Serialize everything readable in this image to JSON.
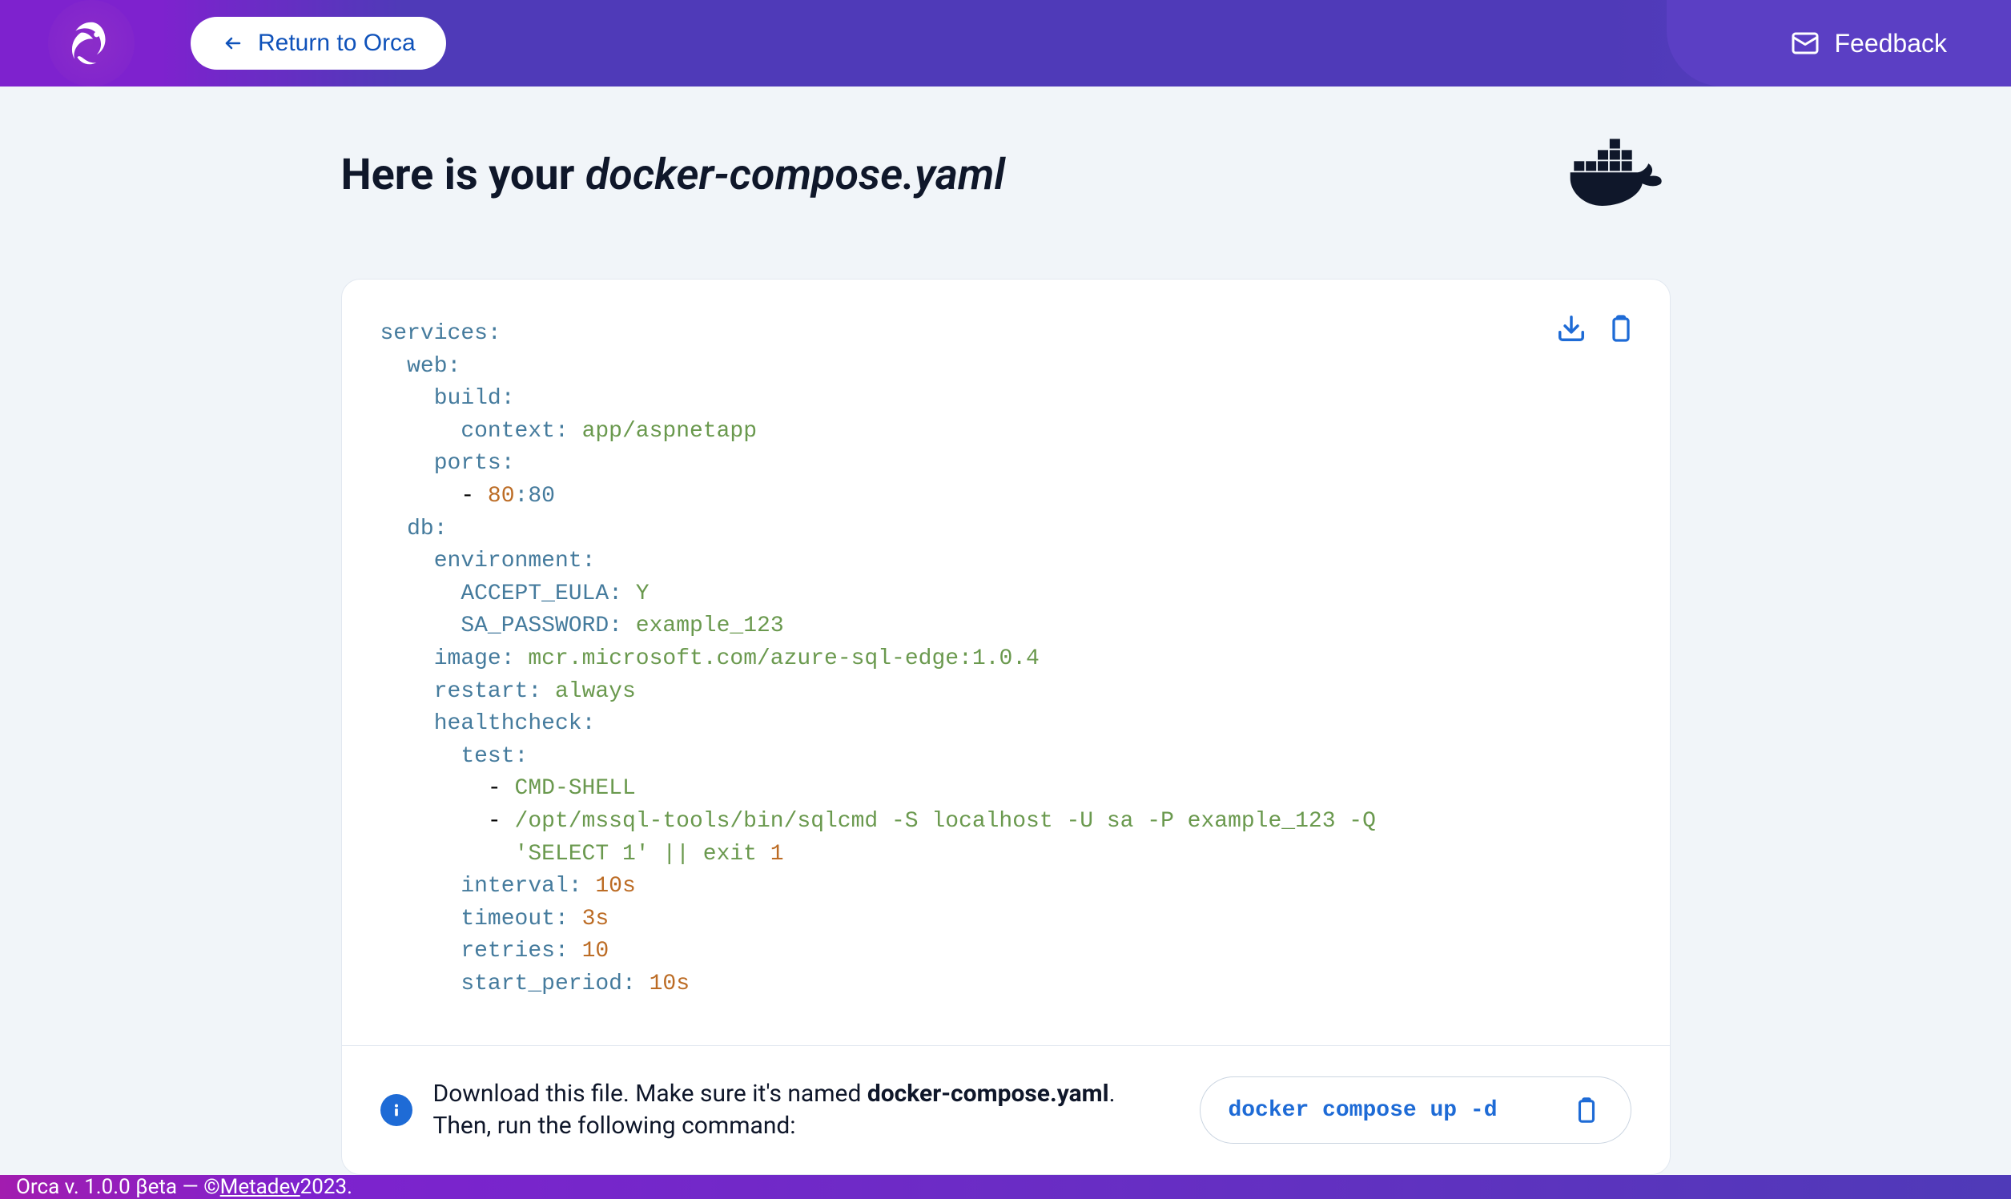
{
  "header": {
    "return_label": "Return to Orca",
    "feedback_label": "Feedback"
  },
  "title": {
    "prefix": "Here is your ",
    "filename": "docker-compose.yaml"
  },
  "code": {
    "tokens": [
      {
        "t": "services",
        "c": "key"
      },
      {
        "t": ":",
        "c": "punct"
      },
      {
        "t": "\n"
      },
      {
        "t": "  "
      },
      {
        "t": "web",
        "c": "key"
      },
      {
        "t": ":",
        "c": "punct"
      },
      {
        "t": "\n"
      },
      {
        "t": "    "
      },
      {
        "t": "build",
        "c": "key"
      },
      {
        "t": ":",
        "c": "punct"
      },
      {
        "t": "\n"
      },
      {
        "t": "      "
      },
      {
        "t": "context",
        "c": "key"
      },
      {
        "t": ":",
        "c": "punct"
      },
      {
        "t": " "
      },
      {
        "t": "app/aspnetapp",
        "c": "str"
      },
      {
        "t": "\n"
      },
      {
        "t": "    "
      },
      {
        "t": "ports",
        "c": "key"
      },
      {
        "t": ":",
        "c": "punct"
      },
      {
        "t": "\n"
      },
      {
        "t": "      - "
      },
      {
        "t": "80",
        "c": "num"
      },
      {
        "t": ":80",
        "c": "key"
      },
      {
        "t": "\n"
      },
      {
        "t": "  "
      },
      {
        "t": "db",
        "c": "key"
      },
      {
        "t": ":",
        "c": "punct"
      },
      {
        "t": "\n"
      },
      {
        "t": "    "
      },
      {
        "t": "environment",
        "c": "key"
      },
      {
        "t": ":",
        "c": "punct"
      },
      {
        "t": "\n"
      },
      {
        "t": "      "
      },
      {
        "t": "ACCEPT_EULA",
        "c": "key"
      },
      {
        "t": ":",
        "c": "punct"
      },
      {
        "t": " "
      },
      {
        "t": "Y",
        "c": "str"
      },
      {
        "t": "\n"
      },
      {
        "t": "      "
      },
      {
        "t": "SA_PASSWORD",
        "c": "key"
      },
      {
        "t": ":",
        "c": "punct"
      },
      {
        "t": " "
      },
      {
        "t": "example_123",
        "c": "str"
      },
      {
        "t": "\n"
      },
      {
        "t": "    "
      },
      {
        "t": "image",
        "c": "key"
      },
      {
        "t": ":",
        "c": "punct"
      },
      {
        "t": " "
      },
      {
        "t": "mcr.microsoft.com/azure-sql-edge:1.0.4",
        "c": "str"
      },
      {
        "t": "\n"
      },
      {
        "t": "    "
      },
      {
        "t": "restart",
        "c": "key"
      },
      {
        "t": ":",
        "c": "punct"
      },
      {
        "t": " "
      },
      {
        "t": "always",
        "c": "str"
      },
      {
        "t": "\n"
      },
      {
        "t": "    "
      },
      {
        "t": "healthcheck",
        "c": "key"
      },
      {
        "t": ":",
        "c": "punct"
      },
      {
        "t": "\n"
      },
      {
        "t": "      "
      },
      {
        "t": "test",
        "c": "key"
      },
      {
        "t": ":",
        "c": "punct"
      },
      {
        "t": "\n"
      },
      {
        "t": "        - "
      },
      {
        "t": "CMD-SHELL",
        "c": "str"
      },
      {
        "t": "\n"
      },
      {
        "t": "        - "
      },
      {
        "t": "/opt/mssql-tools/bin/sqlcmd -S localhost -U sa -P example_123 -Q",
        "c": "str"
      },
      {
        "t": "\n"
      },
      {
        "t": "          "
      },
      {
        "t": "'SELECT 1' || exit ",
        "c": "str"
      },
      {
        "t": "1",
        "c": "num"
      },
      {
        "t": "\n"
      },
      {
        "t": "      "
      },
      {
        "t": "interval",
        "c": "key"
      },
      {
        "t": ":",
        "c": "punct"
      },
      {
        "t": " "
      },
      {
        "t": "10s",
        "c": "num"
      },
      {
        "t": "\n"
      },
      {
        "t": "      "
      },
      {
        "t": "timeout",
        "c": "key"
      },
      {
        "t": ":",
        "c": "punct"
      },
      {
        "t": " "
      },
      {
        "t": "3s",
        "c": "num"
      },
      {
        "t": "\n"
      },
      {
        "t": "      "
      },
      {
        "t": "retries",
        "c": "key"
      },
      {
        "t": ":",
        "c": "punct"
      },
      {
        "t": " "
      },
      {
        "t": "10",
        "c": "num"
      },
      {
        "t": "\n"
      },
      {
        "t": "      "
      },
      {
        "t": "start_period",
        "c": "key"
      },
      {
        "t": ":",
        "c": "punct"
      },
      {
        "t": " "
      },
      {
        "t": "10s",
        "c": "num"
      }
    ]
  },
  "instruction": {
    "line1_pre": "Download this file. Make sure it's named ",
    "line1_fname": "docker-compose.yaml",
    "line1_post": ".",
    "line2": "Then, run the following command:"
  },
  "command": "docker compose up -d",
  "footer": {
    "pre": "Orca v. 1.0.0 βeta — © ",
    "link": "Metadev",
    "post": " 2023."
  }
}
